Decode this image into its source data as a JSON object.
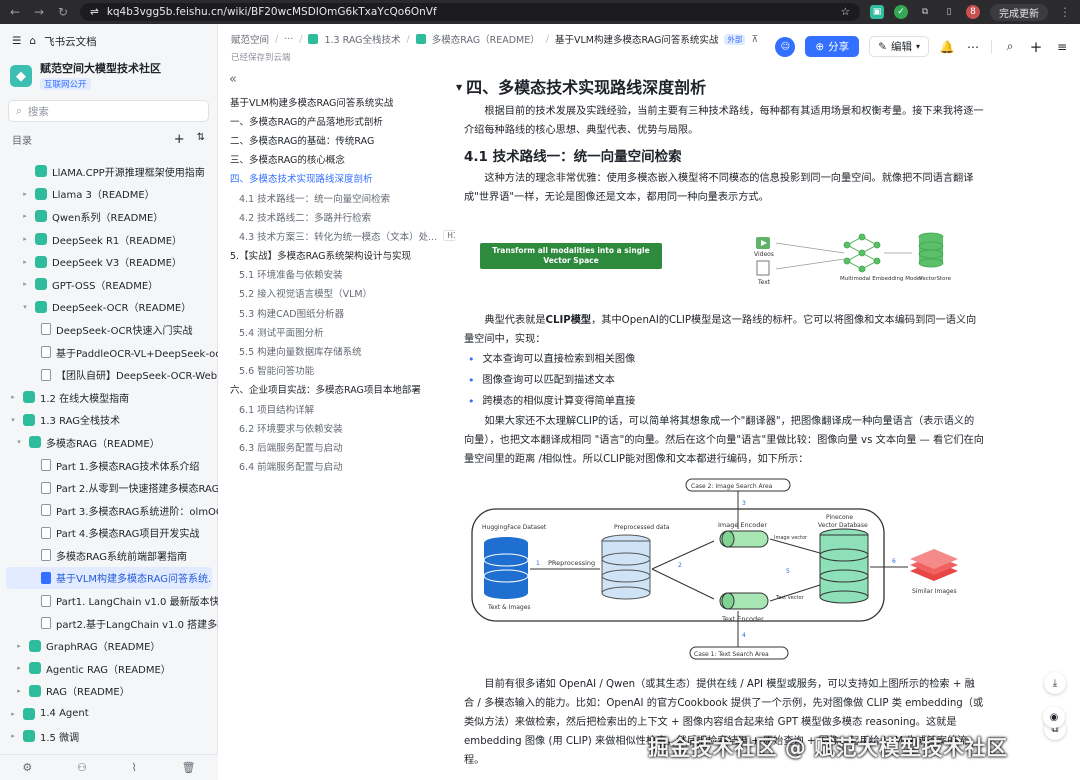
{
  "browser": {
    "url": "kq4b3vgg5b.feishu.cn/wiki/BF20wcMSDIOmG6kTxaYcQo6OnVf",
    "update_label": "完成更新",
    "profile_letter": "8"
  },
  "sidebar": {
    "app_title": "飞书云文档",
    "space_name": "赋范空间大模型技术社区",
    "space_badge": "互联网公开",
    "search_placeholder": "搜索",
    "toc_label": "目录",
    "items": [
      {
        "label": "LlAMA.CPP开源推理框架使用指南",
        "indent": 2,
        "arrow": "",
        "icon": "green"
      },
      {
        "label": "Llama 3（README）",
        "indent": 2,
        "arrow": "▸",
        "icon": "green"
      },
      {
        "label": "Qwen系列（README）",
        "indent": 2,
        "arrow": "▸",
        "icon": "green"
      },
      {
        "label": "DeepSeek R1（README）",
        "indent": 2,
        "arrow": "▸",
        "icon": "green"
      },
      {
        "label": "DeepSeek V3（README）",
        "indent": 2,
        "arrow": "▸",
        "icon": "green"
      },
      {
        "label": "GPT-OSS（README）",
        "indent": 2,
        "arrow": "▸",
        "icon": "green"
      },
      {
        "label": "DeepSeek-OCR（README）",
        "indent": 2,
        "arrow": "▾",
        "icon": "green"
      },
      {
        "label": "DeepSeek-OCR快速入门实战",
        "indent": 3,
        "arrow": "",
        "icon": "doc"
      },
      {
        "label": "基于PaddleOCR-VL+DeepSeek-ocr...",
        "indent": 3,
        "arrow": "",
        "icon": "doc"
      },
      {
        "label": "【团队自研】DeepSeek-OCR-Web ...",
        "indent": 3,
        "arrow": "",
        "icon": "doc"
      },
      {
        "label": "1.2 在线大模型指南",
        "indent": 0,
        "arrow": "▸",
        "icon": "green"
      },
      {
        "label": "1.3 RAG全栈技术",
        "indent": 0,
        "arrow": "▾",
        "icon": "green"
      },
      {
        "label": "多模态RAG（README）",
        "indent": 1,
        "arrow": "▾",
        "icon": "green"
      },
      {
        "label": "Part 1.多模态RAG技术体系介绍",
        "indent": 3,
        "arrow": "",
        "icon": "doc"
      },
      {
        "label": "Part 2.从零到一快速搭建多模态RAG...",
        "indent": 3,
        "arrow": "",
        "icon": "doc"
      },
      {
        "label": "Part 3.多模态RAG系统进阶：olmOC...",
        "indent": 3,
        "arrow": "",
        "icon": "doc"
      },
      {
        "label": "Part 4.多模态RAG项目开发实战",
        "indent": 3,
        "arrow": "",
        "icon": "doc"
      },
      {
        "label": "多模态RAG系统前端部署指南",
        "indent": 3,
        "arrow": "",
        "icon": "doc"
      },
      {
        "label": "基于VLM构建多模态RAG问答系统...",
        "indent": 3,
        "arrow": "",
        "icon": "docsel",
        "selected": true
      },
      {
        "label": "Part1. LangChain v1.0 最新版本快速...",
        "indent": 3,
        "arrow": "",
        "icon": "doc"
      },
      {
        "label": "part2.基于LangChain v1.0 搭建多模...",
        "indent": 3,
        "arrow": "",
        "icon": "doc"
      },
      {
        "label": "GraphRAG（README）",
        "indent": 1,
        "arrow": "▸",
        "icon": "green"
      },
      {
        "label": "Agentic RAG（README）",
        "indent": 1,
        "arrow": "▸",
        "icon": "green"
      },
      {
        "label": "RAG（README）",
        "indent": 1,
        "arrow": "▸",
        "icon": "green"
      },
      {
        "label": "1.4 Agent",
        "indent": 0,
        "arrow": "▸",
        "icon": "green"
      },
      {
        "label": "1.5 微调",
        "indent": 0,
        "arrow": "▸",
        "icon": "green"
      }
    ]
  },
  "topbar": {
    "crumbs": [
      "赋范空间",
      "···",
      "1.3 RAG全栈技术",
      "多模态RAG（README）"
    ],
    "current": "基于VLM构建多模态RAG问答系统实战",
    "external_badge": "外部",
    "saved": "已经保存到云端",
    "share_label": "分享",
    "edit_label": "编辑"
  },
  "outline": {
    "items": [
      {
        "label": "基于VLM构建多模态RAG问答系统实战",
        "level": 0
      },
      {
        "label": "一、多模态RAG的产品落地形式剖析",
        "level": 1
      },
      {
        "label": "二、多模态RAG的基础：传统RAG",
        "level": 1
      },
      {
        "label": "三、多模态RAG的核心概念",
        "level": 1
      },
      {
        "label": "四、多模态技术实现路线深度剖析",
        "level": 1,
        "active": true
      },
      {
        "label": "4.1 技术路线一：统一向量空间检索",
        "level": 2
      },
      {
        "label": "4.2 技术路线二：多路并行检索",
        "level": 2
      },
      {
        "label": "4.3 技术方案三：转化为统一模态（文本）处...",
        "level": 2,
        "badge": "H1"
      },
      {
        "label": "5.【实战】多模态RAG系统架构设计与实现",
        "level": 1
      },
      {
        "label": "5.1 环境准备与依赖安装",
        "level": 2
      },
      {
        "label": "5.2 接入视觉语言模型（VLM）",
        "level": 2
      },
      {
        "label": "5.3 构建CAD图纸分析器",
        "level": 2
      },
      {
        "label": "5.4 测试平面图分析",
        "level": 2
      },
      {
        "label": "5.5 构建向量数据库存储系统",
        "level": 2
      },
      {
        "label": "5.6 智能问答功能",
        "level": 2
      },
      {
        "label": "六、企业项目实战：多模态RAG项目本地部署",
        "level": 1
      },
      {
        "label": "6.1 项目结构详解",
        "level": 2
      },
      {
        "label": "6.2 环境要求与依赖安装",
        "level": 2
      },
      {
        "label": "6.3 后端服务配置与启动",
        "level": 2
      },
      {
        "label": "6.4 前端服务配置与启动",
        "level": 2
      }
    ]
  },
  "doc": {
    "h1": "四、多模态技术实现路线深度剖析",
    "intro": "根据目前的技术发展及实践经验，当前主要有三种技术路线，每种都有其适用场景和权衡考量。接下来我将逐一介绍每种路线的核心思想、典型代表、优势与局限。",
    "h2": "4.1 技术路线一：统一向量空间检索",
    "p1": "这种方法的理念非常优雅：使用多模态嵌入模型将不同模态的信息投影到同一向量空间。就像把不同语言翻译成\"世界语\"一样，无论是图像还是文本，都用同一种向量表示方式。",
    "fig1": {
      "green_box": "Transform all modalities into a single Vector Space",
      "videos": "Videos",
      "text": "Text",
      "model": "Multimodal Embedding Model",
      "store": "VectorStore"
    },
    "p2_pre": "典型代表就是",
    "p2_bold": "CLIP模型",
    "p2_post": "，其中OpenAI的CLIP模型是这一路线的标杆。它可以将图像和文本编码到同一语义向量空间中，实现：",
    "bullets": [
      "文本查询可以直接检索到相关图像",
      "图像查询可以匹配到描述文本",
      "跨模态的相似度计算变得简单直接"
    ],
    "p3": "如果大家还不太理解CLIP的话，可以简单将其想象成一个\"翻译器\"，把图像翻译成一种向量语言（表示语义的向量），也把文本翻译成相同 \"语言\"的向量。然后在这个向量\"语言\"里做比较：图像向量 vs 文本向量 — 看它们在向量空间里的距离 /相似性。所以CLIP能对图像和文本都进行编码，如下所示：",
    "fig2": {
      "case2": "Case 2: Image Search Area",
      "case1": "Case 1: Text Search Area",
      "dataset": "HuggingFace Dataset",
      "preprocessed": "Preprocessed data",
      "preprocessing": "PReprocessing",
      "img_encoder": "Image Encoder",
      "txt_encoder": "Text Encoder",
      "pinecone": "Pinecone",
      "vdb": "Vector Database",
      "text_images": "Text & Images",
      "similar": "Similar Images",
      "img_vector": "Image vector",
      "text_vector": "Text vector",
      "n1": "1",
      "n2": "2",
      "n3": "3",
      "n4": "4",
      "n5": "5",
      "n6": "6"
    },
    "p4": "目前有很多诸如 OpenAI / Qwen（或其生态）提供在线 / API 模型或服务，可以支持如上图所示的检索 + 融合 / 多模态输入的能力。比如：OpenAI 的官方Cookbook 提供了一个示例，先对图像做 CLIP 类 embedding（或类似方法）来做检索，然后把检索出的上下文 + 图像内容组合起来给 GPT 模型做多模态 reasoning。这就是 embedding 图像 (用 CLIP) 来做相似性检索，然后把检索结果 + 原始查询 + 图像一起用给 LLM 生成答案的流程。",
    "watermark": "掘金技术社区 @ 赋范大模型技术社区"
  }
}
